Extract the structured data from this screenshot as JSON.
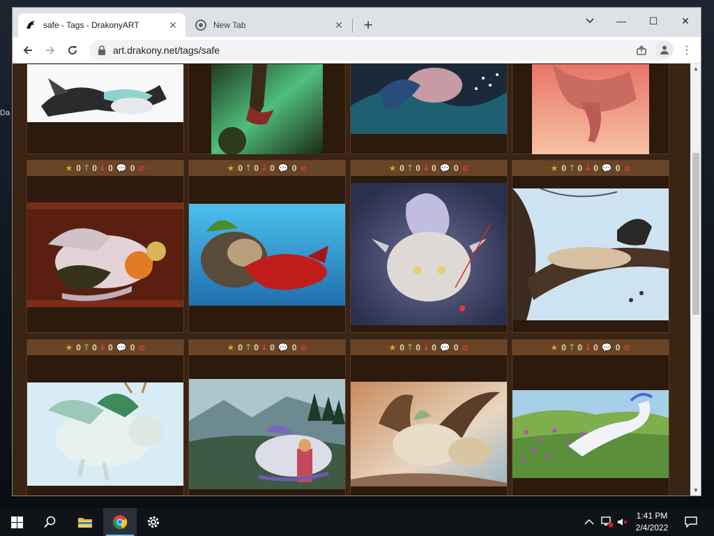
{
  "desktop": {
    "fragment_text": "Da"
  },
  "browser": {
    "tabs": [
      {
        "title": "safe - Tags - DrakonyART",
        "active": true
      },
      {
        "title": "New Tab",
        "active": false
      }
    ],
    "url": "art.drakony.net/tags/safe",
    "window_controls": {
      "minimize": "—",
      "maximize": "☐",
      "close": "✕"
    }
  },
  "gallery": {
    "row1_cards": [
      {
        "stats": {
          "favorites": "0",
          "upvotes": "0",
          "downvotes": "0",
          "comments": "0"
        }
      },
      {
        "stats": {
          "favorites": "0",
          "upvotes": "0",
          "downvotes": "0",
          "comments": "0"
        }
      },
      {
        "stats": {
          "favorites": "0",
          "upvotes": "0",
          "downvotes": "0",
          "comments": "0"
        }
      },
      {
        "stats": {
          "favorites": "0",
          "upvotes": "0",
          "downvotes": "0",
          "comments": "0"
        }
      }
    ],
    "row2_cards": [
      {
        "stats": {
          "favorites": "0",
          "upvotes": "0",
          "downvotes": "0",
          "comments": "0"
        }
      },
      {
        "stats": {
          "favorites": "0",
          "upvotes": "0",
          "downvotes": "0",
          "comments": "0"
        }
      },
      {
        "stats": {
          "favorites": "0",
          "upvotes": "0",
          "downvotes": "0",
          "comments": "0"
        }
      },
      {
        "stats": {
          "favorites": "0",
          "upvotes": "0",
          "downvotes": "0",
          "comments": "0"
        }
      }
    ],
    "colors": {
      "page_bg": "#3a2414",
      "stats_bar": "#6a4427",
      "card_bg": "#2c1a0c"
    }
  },
  "taskbar": {
    "time": "1:41 PM",
    "date": "2/4/2022"
  }
}
